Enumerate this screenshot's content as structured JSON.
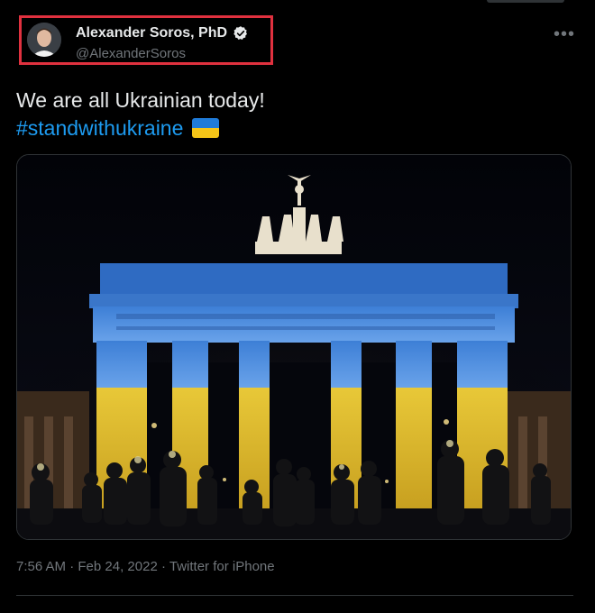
{
  "author": {
    "name": "Alexander Soros, PhD",
    "handle": "@AlexanderSoros",
    "verified": true
  },
  "tweet": {
    "text": "We are all Ukrainian today!",
    "hashtag": "#standwithukraine",
    "flag_emoji": "ukraine-flag"
  },
  "meta": {
    "time": "7:56 AM",
    "separator": "·",
    "date": "Feb 24, 2022",
    "source": "Twitter for iPhone"
  },
  "colors": {
    "background": "#000000",
    "text": "#e7e9ea",
    "muted": "#71767b",
    "link": "#1d9bf0",
    "highlight_box": "#e0313f",
    "flag_blue": "#1f7bd8",
    "flag_yellow": "#f5c518"
  },
  "icons": {
    "verified": "verified-badge-icon",
    "more": "more-options-icon"
  }
}
